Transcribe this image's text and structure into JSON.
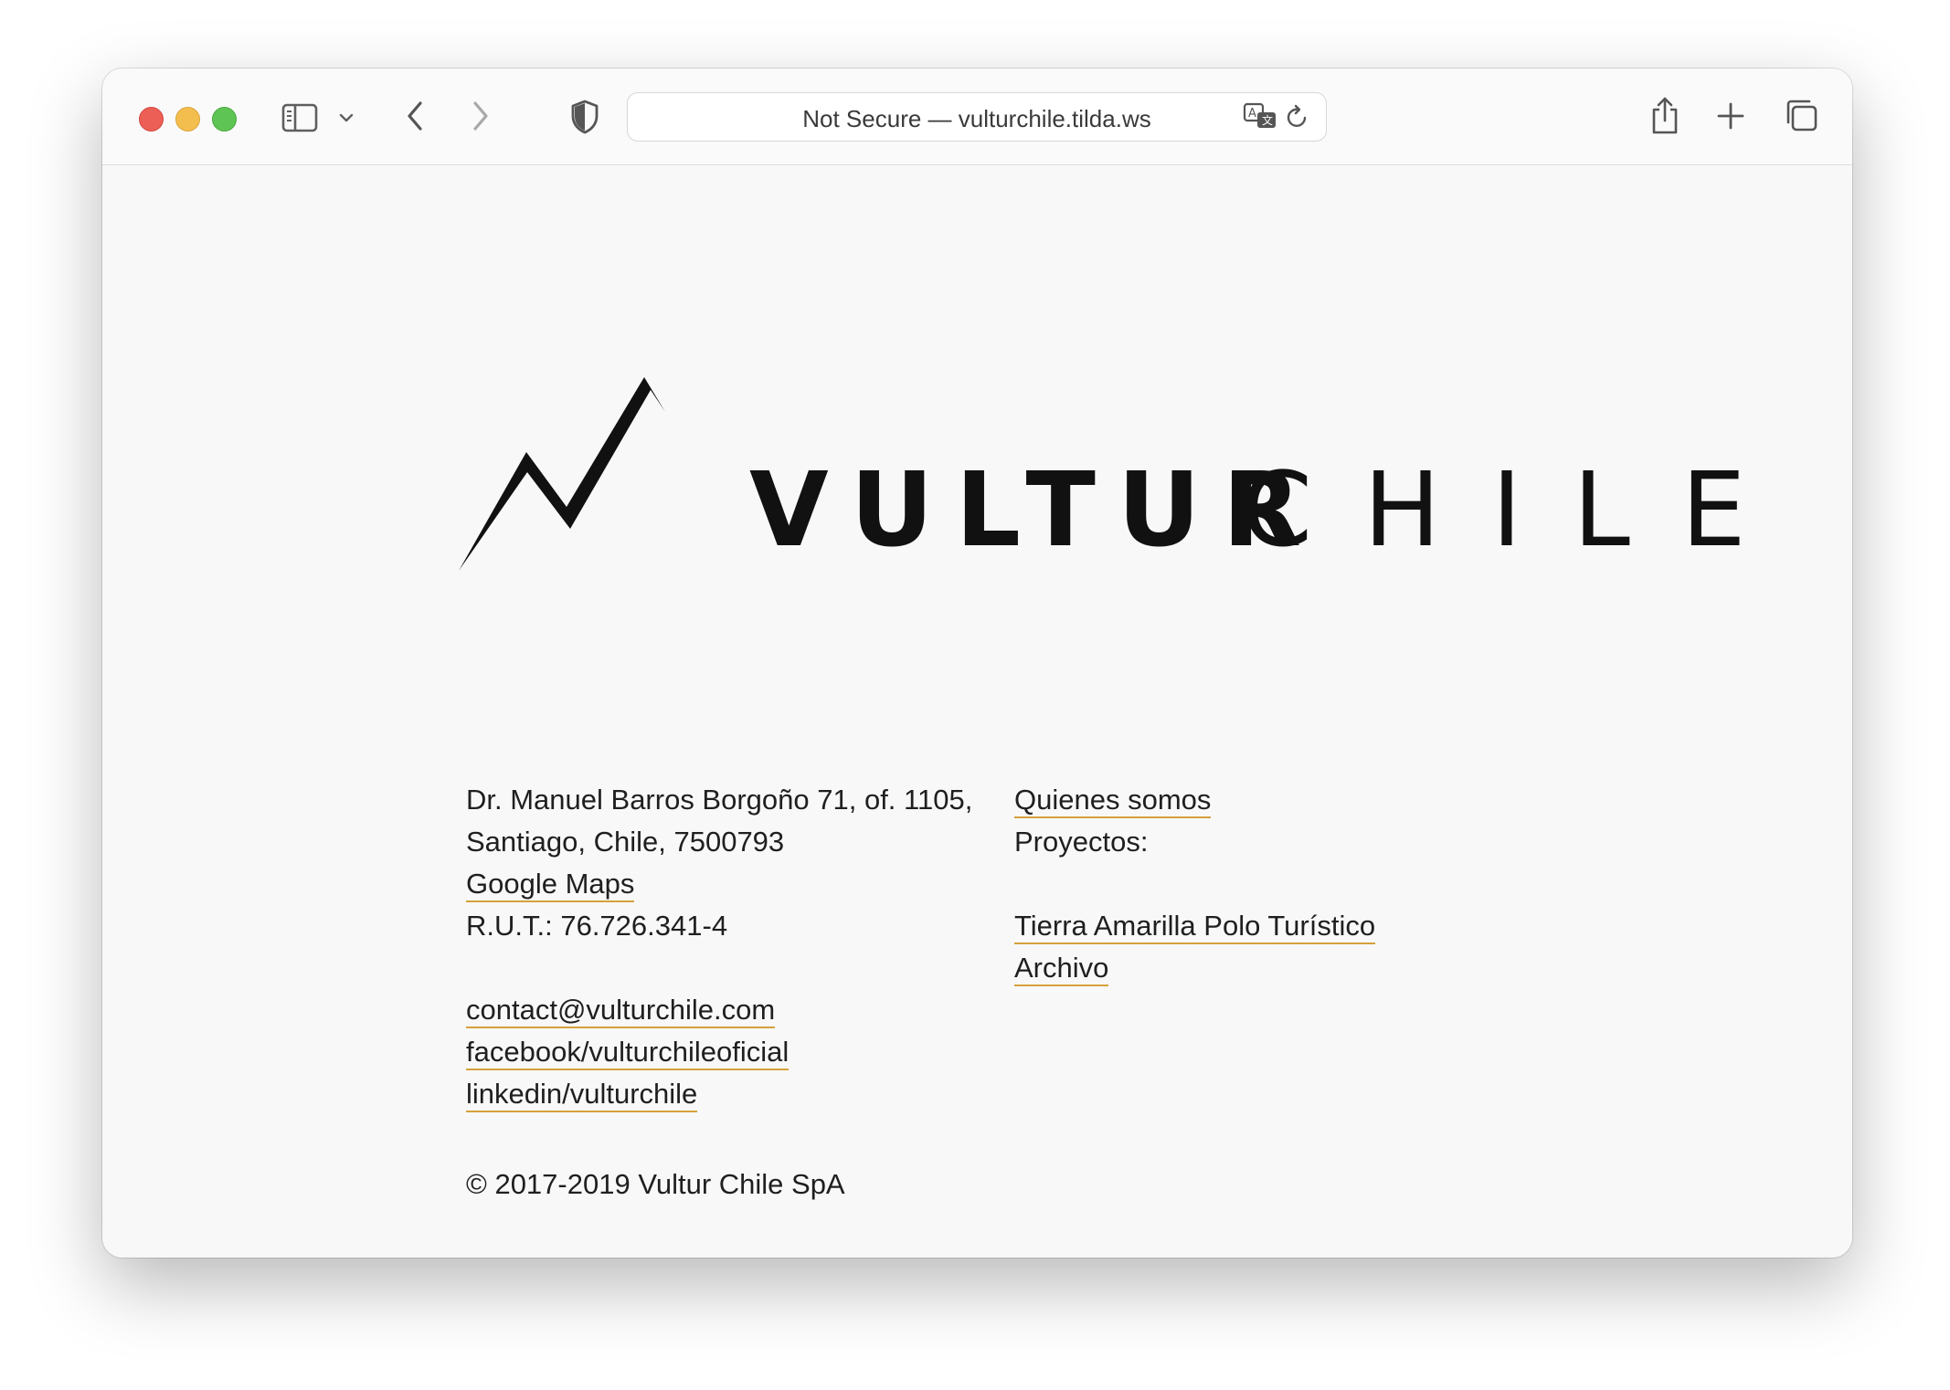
{
  "browser": {
    "address_bar": "Not Secure — vulturchile.tilda.ws",
    "icons": {
      "sidebar": "sidebar-icon",
      "sidebar_menu": "chevron-down-icon",
      "back": "back-icon",
      "forward": "forward-icon",
      "privacy": "shield-icon",
      "translate": "translate-icon",
      "reload": "reload-icon",
      "share": "share-icon",
      "new_tab": "plus-icon",
      "tabs": "tabs-overview-icon"
    }
  },
  "logo": {
    "bold_text": "VULTUR",
    "light_text": "CHILE"
  },
  "footer": {
    "address_line1": "Dr. Manuel Barros Borgoño 71, of. 1105,",
    "address_line2": "Santiago, Chile, 7500793",
    "maps_link": "Google Maps",
    "rut": "R.U.T.: 76.726.341-4",
    "email_link": "contact@vulturchile.com",
    "facebook_link": "facebook/vulturchileoficial",
    "linkedin_link": "linkedin/vulturchile",
    "about_link": "Quienes somos",
    "projects_label": "Proyectos:",
    "project_link": "Tierra Amarilla Polo Turístico",
    "archive_link": "Archivo",
    "copyright": "© 2017-2019 Vultur Chile SpA"
  },
  "colors": {
    "link_underline": "#d6a13c",
    "background": "#f8f8f8",
    "text": "#1f1f1f"
  }
}
